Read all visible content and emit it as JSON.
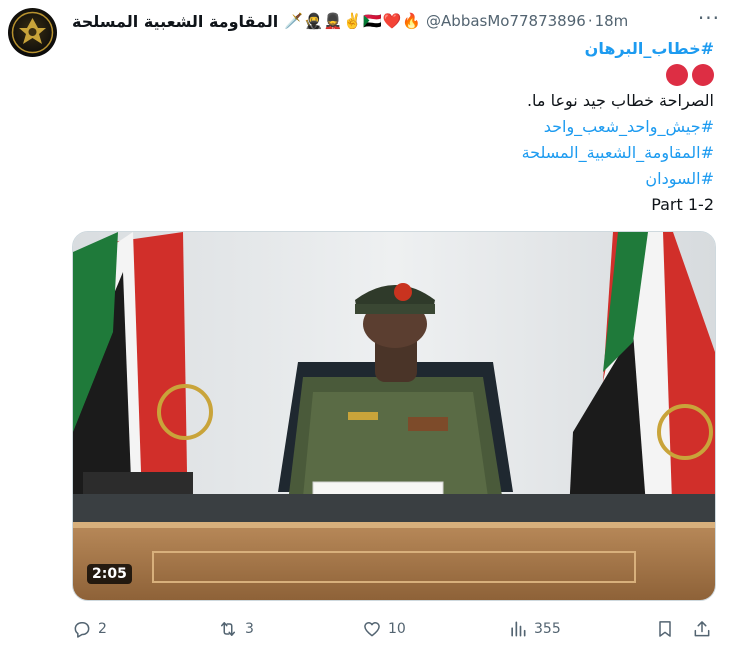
{
  "author": {
    "display_name": "المقاومة الشعبية المسلحة",
    "emojis": "🗡️🥷💂✌️🇸🇩❤️🔥",
    "handle": "@AbbasMo77873896",
    "separator": "·",
    "time": "18m"
  },
  "tweet": {
    "hashtag_burhan": "#خطاب_البرهان",
    "line_frankness": "الصراحة خطاب جيد نوعا ما.",
    "hashtag_army": "#جيش_واحد_شعب_واحد",
    "hashtag_resistance": "#المقاومة_الشعبية_المسلحة",
    "hashtag_sudan": "#السودان",
    "part_label": "Part 1-2"
  },
  "media": {
    "duration": "2:05"
  },
  "actions": {
    "replies": "2",
    "reposts": "3",
    "likes": "10",
    "views": "355"
  },
  "colors": {
    "accent": "#1d9bf0",
    "muted": "#536471",
    "red_circle": "#dd2e44"
  },
  "icons": [
    "more-icon",
    "reply-icon",
    "retweet-icon",
    "like-icon",
    "views-icon",
    "bookmark-icon",
    "share-icon",
    "red-circle-icon"
  ]
}
